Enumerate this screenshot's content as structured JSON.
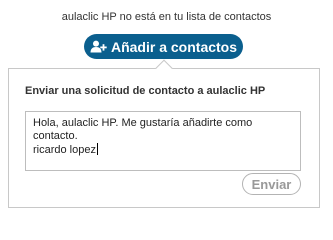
{
  "header": {
    "notice": "aulaclic HP no está en tu lista de contactos",
    "add_button_label": "Añadir a contactos",
    "add_button_icon": "add-person-icon",
    "accent_color": "#0b5f8e"
  },
  "request_panel": {
    "title": "Enviar una solicitud de contacto a aulaclic HP",
    "message_lines": [
      "Hola, aulaclic HP. Me gustaría añadirte como",
      "contacto.",
      "ricardo lopez"
    ],
    "send_button_label": "Enviar"
  }
}
